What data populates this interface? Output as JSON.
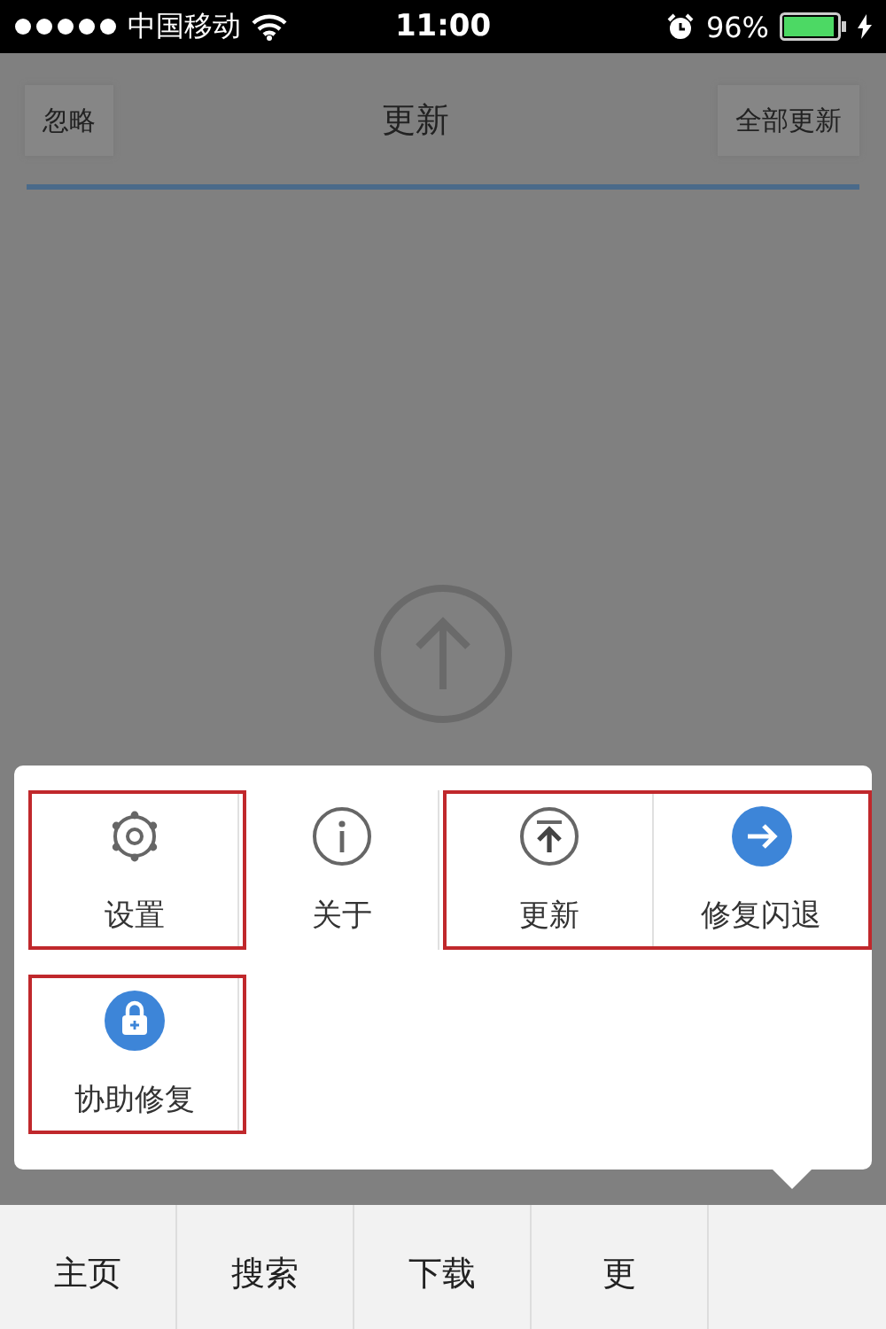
{
  "status_bar": {
    "carrier": "中国移动",
    "time": "11:00",
    "battery": "96%"
  },
  "header": {
    "left_button": "忽略",
    "title": "更新",
    "right_button": "全部更新"
  },
  "menu": {
    "rows": [
      [
        {
          "label": "设置",
          "marked": true
        },
        {
          "label": "关于",
          "marked": false
        },
        {
          "label": "更新",
          "marked": true
        },
        {
          "label": "修复闪退",
          "marked": true
        }
      ],
      [
        {
          "label": "协助修复",
          "marked": true
        }
      ]
    ]
  },
  "tab_bar": {
    "tabs": [
      {
        "label": "主页"
      },
      {
        "label": "搜索"
      },
      {
        "label": "下载"
      },
      {
        "label": "更"
      }
    ]
  }
}
